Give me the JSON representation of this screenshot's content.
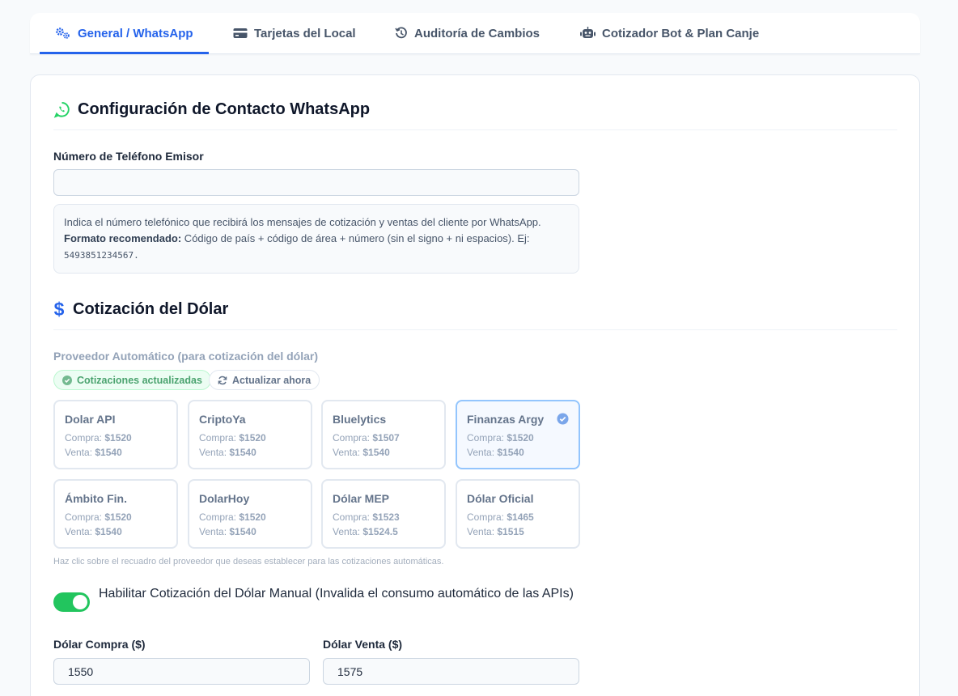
{
  "tabs": [
    {
      "label": "General / WhatsApp",
      "icon": "cogs-icon",
      "active": true
    },
    {
      "label": "Tarjetas del Local",
      "icon": "credit-card-icon",
      "active": false
    },
    {
      "label": "Auditoría de Cambios",
      "icon": "history-icon",
      "active": false
    },
    {
      "label": "Cotizador Bot & Plan Canje",
      "icon": "robot-icon",
      "active": false
    }
  ],
  "whatsapp": {
    "title": "Configuración de Contacto WhatsApp",
    "phone_label": "Número de Teléfono Emisor",
    "phone_value": "",
    "help_line1": "Indica el número telefónico que recibirá los mensajes de cotización y ventas del cliente por WhatsApp.",
    "help_bold": "Formato recomendado:",
    "help_rest": " Código de país + código de área + número (sin el signo + ni espacios). Ej:",
    "help_example": "5493851234567."
  },
  "dolar": {
    "title": "Cotización del Dólar",
    "provider_label": "Proveedor Automático (para cotización del dólar)",
    "status_badge": "Cotizaciones actualizadas",
    "refresh_label": "Actualizar ahora",
    "compra_prefix": "Compra: ",
    "venta_prefix": "Venta: ",
    "providers": [
      {
        "name": "Dolar API",
        "compra": "$1520",
        "venta": "$1540",
        "selected": false
      },
      {
        "name": "CriptoYa",
        "compra": "$1520",
        "venta": "$1540",
        "selected": false
      },
      {
        "name": "Bluelytics",
        "compra": "$1507",
        "venta": "$1540",
        "selected": false
      },
      {
        "name": "Finanzas Argy",
        "compra": "$1520",
        "venta": "$1540",
        "selected": true
      },
      {
        "name": "Ámbito Fin.",
        "compra": "$1520",
        "venta": "$1540",
        "selected": false
      },
      {
        "name": "DolarHoy",
        "compra": "$1520",
        "venta": "$1540",
        "selected": false
      },
      {
        "name": "Dólar MEP",
        "compra": "$1523",
        "venta": "$1524.5",
        "selected": false
      },
      {
        "name": "Dólar Oficial",
        "compra": "$1465",
        "venta": "$1515",
        "selected": false
      }
    ],
    "hint": "Haz clic sobre el recuadro del proveedor que deseas establecer para las cotizaciones automáticas.",
    "manual_toggle_on": true,
    "manual_label": "Habilitar Cotización del Dólar Manual (Invalida el consumo automático de las APIs)",
    "compra_label": "Dólar Compra ($)",
    "compra_value": "1550",
    "venta_label": "Dólar Venta ($)",
    "venta_value": "1575"
  },
  "colors": {
    "accent": "#2563eb",
    "whatsapp_green": "#25d366",
    "toggle_green": "#22c55e",
    "selected_border": "#93c5fd"
  }
}
